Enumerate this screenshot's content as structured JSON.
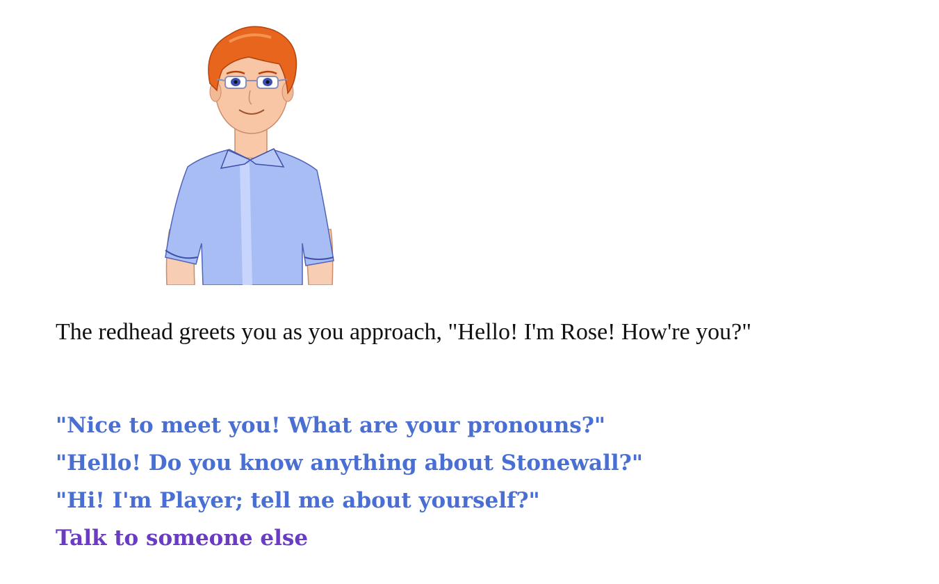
{
  "character": {
    "portrait_icon": "redhead-character-portrait",
    "hair_color": "#e8651e",
    "shirt_color": "#a9bdf5"
  },
  "narration": "The redhead greets you as you approach, \"Hello! I'm Rose! How're you?\"",
  "choices": [
    {
      "label": "\"Nice to meet you! What are your pronouns?\""
    },
    {
      "label": "\"Hello! Do you know anything about Stonewall?\""
    },
    {
      "label": "\"Hi! I'm Player; tell me about yourself?\""
    },
    {
      "label": "Talk to someone else"
    }
  ],
  "colors": {
    "choice_link": "#4a6fd2",
    "leave_link": "#6a3cc4",
    "text": "#111111"
  }
}
